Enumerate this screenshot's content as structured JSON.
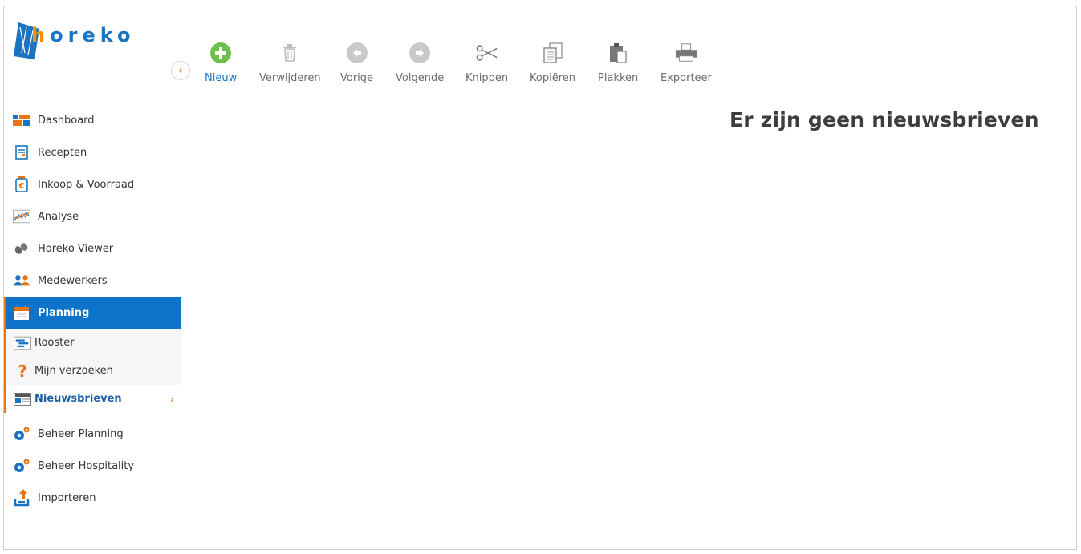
{
  "app": {
    "logo_text_h": "h",
    "logo_text_rest": "oreko"
  },
  "sidebar": {
    "items": [
      {
        "label": "Dashboard",
        "icon": "dashboard-icon"
      },
      {
        "label": "Recepten",
        "icon": "recipe-icon"
      },
      {
        "label": "Inkoop & Voorraad",
        "icon": "euro-jar-icon"
      },
      {
        "label": "Analyse",
        "icon": "chart-icon"
      },
      {
        "label": "Horeko Viewer",
        "icon": "binoculars-icon"
      },
      {
        "label": "Medewerkers",
        "icon": "users-icon"
      },
      {
        "label": "Planning",
        "icon": "calendar-icon"
      },
      {
        "label": "Beheer Planning",
        "icon": "gears-icon"
      },
      {
        "label": "Beheer Hospitality",
        "icon": "gears-icon"
      },
      {
        "label": "Importeren",
        "icon": "upload-icon"
      }
    ],
    "planning_sub": [
      {
        "label": "Rooster",
        "icon": "schedule-icon"
      },
      {
        "label": "Mijn verzoeken",
        "icon": "question-icon"
      },
      {
        "label": "Nieuwsbrieven",
        "icon": "newsletter-icon"
      }
    ]
  },
  "toolbar": {
    "buttons": [
      {
        "label": "Nieuw",
        "icon": "add-icon"
      },
      {
        "label": "Verwijderen",
        "icon": "trash-icon"
      },
      {
        "label": "Vorige",
        "icon": "arrow-left-icon"
      },
      {
        "label": "Volgende",
        "icon": "arrow-right-icon"
      },
      {
        "label": "Knippen",
        "icon": "scissors-icon"
      },
      {
        "label": "Kopiëren",
        "icon": "copy-icon"
      },
      {
        "label": "Plakken",
        "icon": "paste-icon"
      },
      {
        "label": "Exporteer",
        "icon": "printer-icon"
      }
    ]
  },
  "main": {
    "empty_message": "Er zijn geen nieuwsbrieven"
  },
  "colors": {
    "accent": "#0d73c8",
    "highlight": "#e8730f",
    "add_green": "#6cc04a"
  }
}
